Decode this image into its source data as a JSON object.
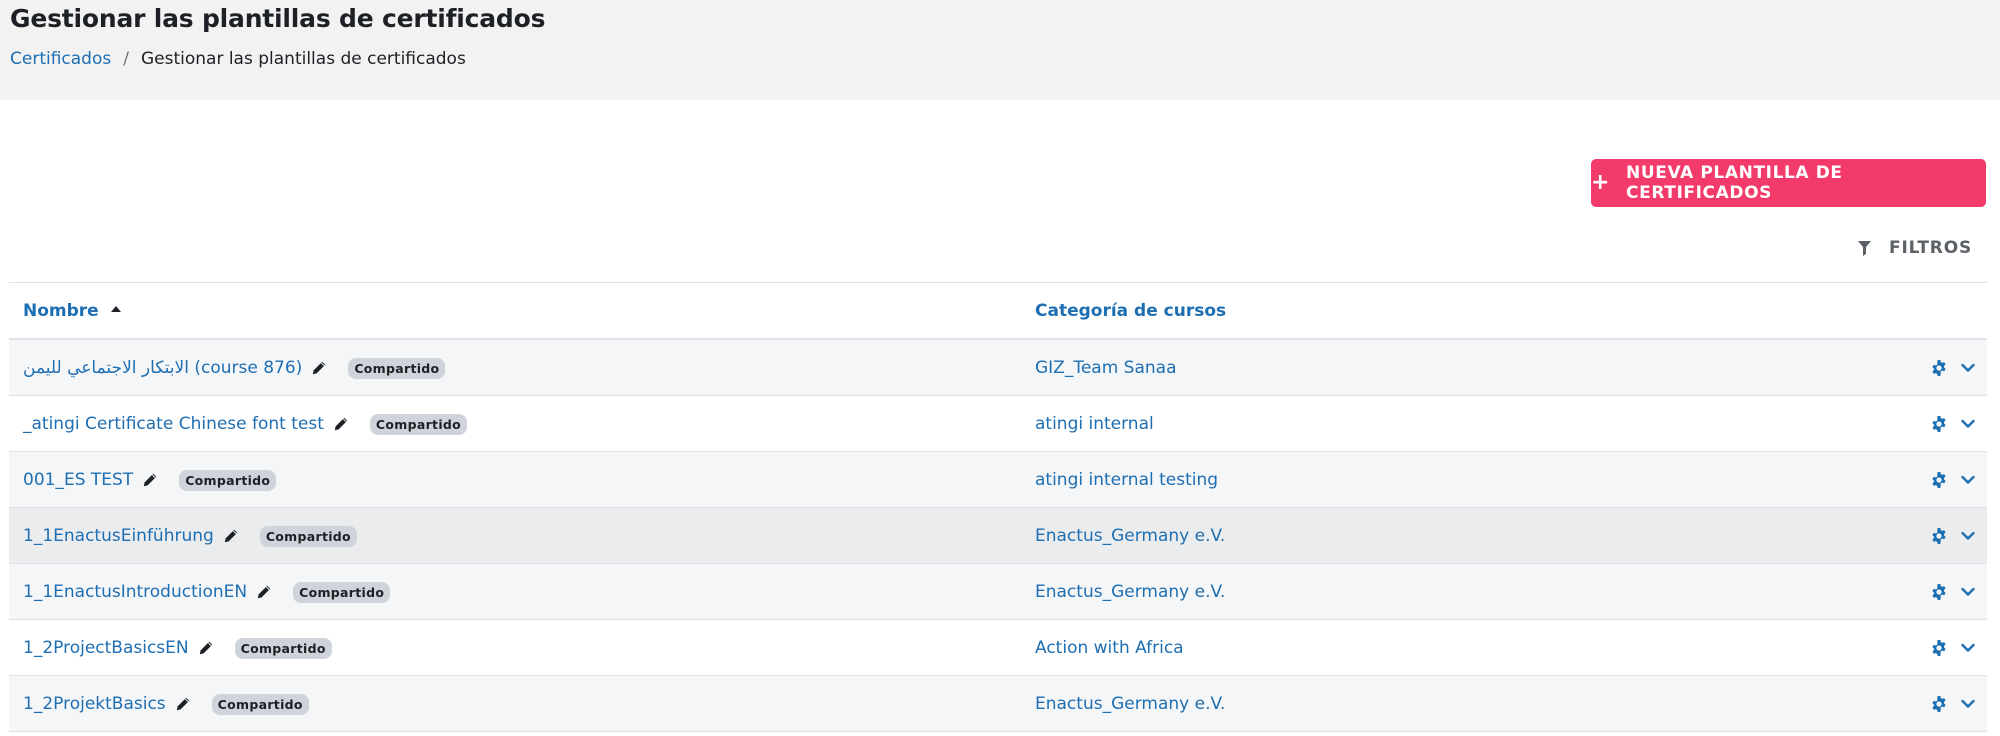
{
  "header": {
    "title": "Gestionar las plantillas de certificados",
    "breadcrumb": {
      "parent": "Certificados",
      "separator": "/",
      "current": "Gestionar las plantillas de certificados"
    }
  },
  "actions": {
    "new_button": "NUEVA PLANTILLA DE CERTIFICADOS",
    "filters": "FILTROS"
  },
  "table": {
    "columns": {
      "name": "Nombre",
      "category": "Categoría de cursos"
    },
    "sort": "name-ascending",
    "rows": [
      {
        "name": "الابتكار الاجتماعي لليمن (course 876)",
        "badge": "Compartido",
        "category": "GIZ_Team Sanaa"
      },
      {
        "name": "_atingi Certificate Chinese font test",
        "badge": "Compartido",
        "category": "atingi internal"
      },
      {
        "name": "001_ES TEST",
        "badge": "Compartido",
        "category": "atingi internal testing"
      },
      {
        "name": "1_1EnactusEinführung",
        "badge": "Compartido",
        "category": "Enactus_Germany e.V."
      },
      {
        "name": "1_1EnactusIntroductionEN",
        "badge": "Compartido",
        "category": "Enactus_Germany e.V."
      },
      {
        "name": "1_2ProjectBasicsEN",
        "badge": "Compartido",
        "category": "Action with Africa"
      },
      {
        "name": "1_2ProjektBasics",
        "badge": "Compartido",
        "category": "Enactus_Germany e.V."
      }
    ]
  },
  "colors": {
    "primary_link": "#1e6eb2",
    "accent_button": "#f23b6b",
    "header_bg": "#f2f2f3"
  }
}
